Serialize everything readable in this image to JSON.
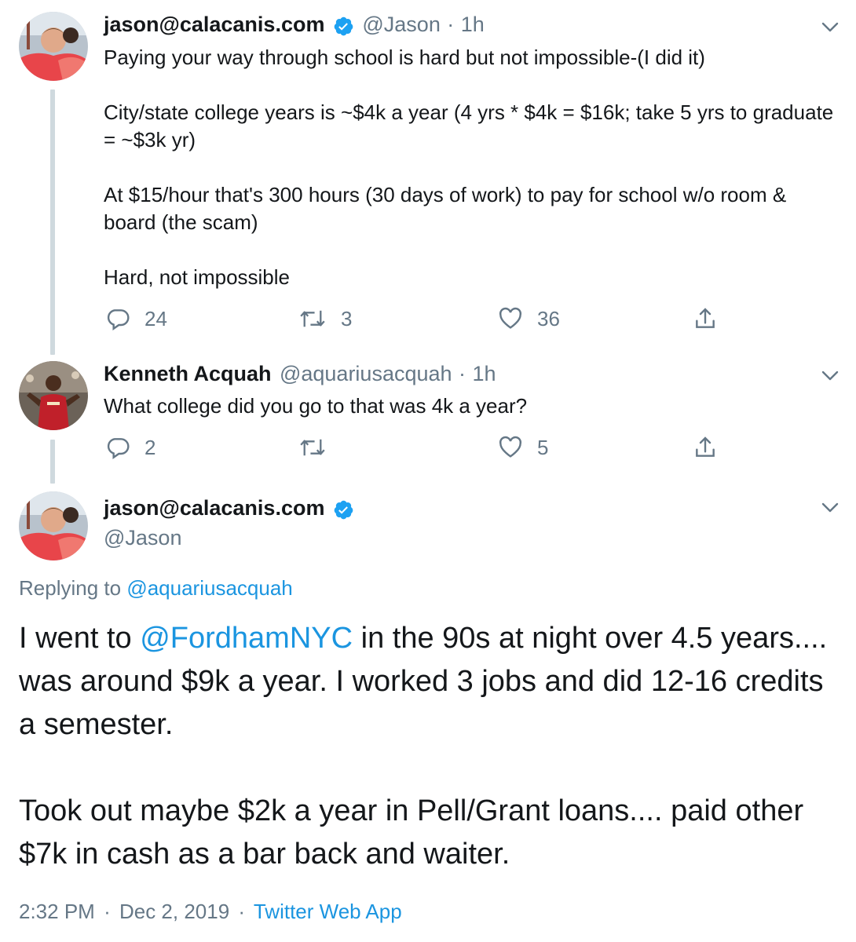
{
  "tweet1": {
    "display_name": "jason@calacanis.com",
    "handle": "@Jason",
    "dot": "·",
    "time": "1h",
    "paragraphs": [
      "Paying your way through school is hard but not impossible-(I did it)",
      "City/state college years is ~$4k a year (4 yrs * $4k = $16k; take 5 yrs to graduate = ~$3k yr)",
      "At $15/hour that's 300 hours (30 days of work) to pay for school w/o room & board (the scam)",
      "Hard, not impossible"
    ],
    "replies": "24",
    "retweets": "3",
    "likes": "36"
  },
  "tweet2": {
    "display_name": "Kenneth Acquah",
    "handle": "@aquariusacquah",
    "dot": "·",
    "time": "1h",
    "text": "What college did you go to that was 4k a year?",
    "replies": "2",
    "retweets": "",
    "likes": "5"
  },
  "tweet3": {
    "display_name": "jason@calacanis.com",
    "handle": "@Jason",
    "replying_prefix": "Replying to ",
    "replying_to": "@aquariusacquah",
    "text_before_mention": "I went to ",
    "mention": "@FordhamNYC",
    "text_after_mention": " in the 90s at night over 4.5 years.... was around $9k a year. I worked 3 jobs and did 12-16 credits a semester.",
    "paragraph2": "Took out maybe $2k a year in Pell/Grant loans.... paid other $7k in cash as a bar back and waiter.",
    "time": "2:32 PM",
    "dot": "·",
    "date": "Dec 2, 2019",
    "dot2": "·",
    "source": "Twitter Web App"
  },
  "colors": {
    "text": "#14171a",
    "secondary": "#657786",
    "link": "#1b95e0",
    "verified": "#1da1f2",
    "thread_line": "#cfd9de"
  },
  "icons": [
    "reply-icon",
    "retweet-icon",
    "like-icon",
    "share-icon",
    "chevron-down-icon",
    "verified-badge-icon"
  ]
}
